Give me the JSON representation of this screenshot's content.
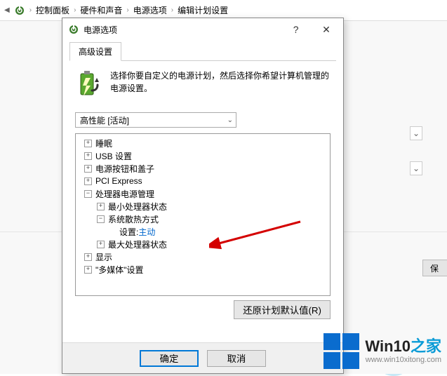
{
  "breadcrumb": {
    "items": [
      "控制面板",
      "硬件和声音",
      "电源选项",
      "编辑计划设置"
    ]
  },
  "bg": {
    "save_label": "保"
  },
  "dialog": {
    "title": "电源选项",
    "tab": "高级设置",
    "intro": "选择你要自定义的电源计划，然后选择你希望计算机管理的电源设置。",
    "plan_dropdown": "高性能 [活动]",
    "tree": {
      "items": [
        {
          "label": "睡眠"
        },
        {
          "label": "USB 设置"
        },
        {
          "label": "电源按钮和盖子"
        },
        {
          "label": "PCI Express"
        },
        {
          "label": "处理器电源管理"
        },
        {
          "label": "最小处理器状态"
        },
        {
          "label": "系统散热方式"
        },
        {
          "label_prefix": "设置: ",
          "value": "主动"
        },
        {
          "label": "最大处理器状态"
        },
        {
          "label": "显示"
        },
        {
          "label": "\"多媒体\"设置"
        }
      ]
    },
    "restore_btn": "还原计划默认值(R)",
    "ok_btn": "确定",
    "cancel_btn": "取消"
  },
  "watermark": {
    "brand_prefix": "Win10",
    "brand_suffix": "之家",
    "url": "www.win10xitong.com"
  }
}
